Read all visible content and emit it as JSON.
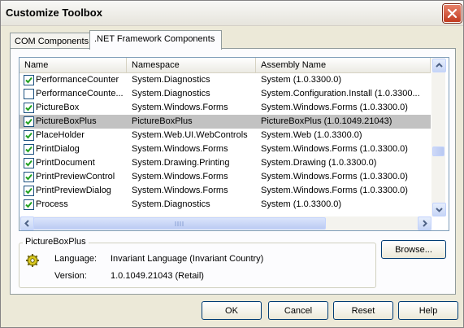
{
  "window": {
    "title": "Customize Toolbox"
  },
  "tabs": [
    {
      "label": "COM Components"
    },
    {
      "label": ".NET Framework Components"
    }
  ],
  "columns": [
    "Name",
    "Namespace",
    "Assembly Name"
  ],
  "rows": [
    {
      "name": "PerformanceCounter",
      "namespace": "System.Diagnostics",
      "assembly": "System (1.0.3300.0)",
      "checked": true
    },
    {
      "name": "PerformanceCounte...",
      "namespace": "System.Diagnostics",
      "assembly": "System.Configuration.Install (1.0.3300...",
      "checked": false
    },
    {
      "name": "PictureBox",
      "namespace": "System.Windows.Forms",
      "assembly": "System.Windows.Forms (1.0.3300.0)",
      "checked": true
    },
    {
      "name": "PictureBoxPlus",
      "namespace": "PictureBoxPlus",
      "assembly": "PictureBoxPlus (1.0.1049.21043)",
      "checked": true
    },
    {
      "name": "PlaceHolder",
      "namespace": "System.Web.UI.WebControls",
      "assembly": "System.Web (1.0.3300.0)",
      "checked": true
    },
    {
      "name": "PrintDialog",
      "namespace": "System.Windows.Forms",
      "assembly": "System.Windows.Forms (1.0.3300.0)",
      "checked": true
    },
    {
      "name": "PrintDocument",
      "namespace": "System.Drawing.Printing",
      "assembly": "System.Drawing (1.0.3300.0)",
      "checked": true
    },
    {
      "name": "PrintPreviewControl",
      "namespace": "System.Windows.Forms",
      "assembly": "System.Windows.Forms (1.0.3300.0)",
      "checked": true
    },
    {
      "name": "PrintPreviewDialog",
      "namespace": "System.Windows.Forms",
      "assembly": "System.Windows.Forms (1.0.3300.0)",
      "checked": true
    },
    {
      "name": "Process",
      "namespace": "System.Diagnostics",
      "assembly": "System (1.0.3300.0)",
      "checked": true
    }
  ],
  "selected_row": "PictureBoxPlus",
  "details": {
    "title": "PictureBoxPlus",
    "language_label": "Language:",
    "language_value": "Invariant Language (Invariant Country)",
    "version_label": "Version:",
    "version_value": "1.0.1049.21043 (Retail)"
  },
  "buttons": {
    "browse": "Browse...",
    "ok": "OK",
    "cancel": "Cancel",
    "reset": "Reset",
    "help": "Help"
  },
  "colors": {
    "selected_row": "#c2c2c2",
    "dialog_bg": "#ece9d8",
    "close_button": "#c23b1f"
  },
  "icons": {
    "close": "close-icon",
    "component": "gear-icon"
  }
}
